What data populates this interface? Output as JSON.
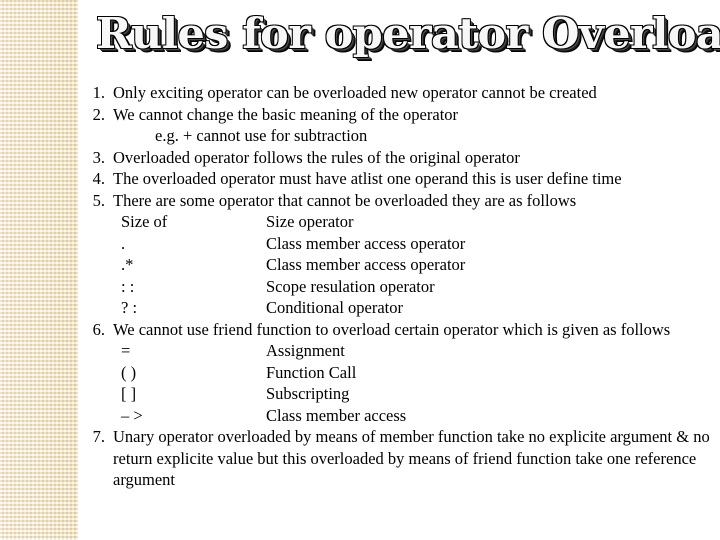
{
  "slide": {
    "title": "Rules for operator Overloading",
    "background_color": "#ffffff",
    "text_color": "#000000",
    "sidebar_color": "#f0e3c2"
  },
  "rules": [
    {
      "number": "1.",
      "text": "Only exciting operator can be overloaded new operator cannot be created"
    },
    {
      "number": "2.",
      "text": "We cannot change the basic meaning of the operator",
      "subnote": "e.g. + cannot use for subtraction"
    },
    {
      "number": "3.",
      "text": "Overloaded operator follows the rules of the original operator"
    },
    {
      "number": "4.",
      "text": "The overloaded operator must have atlist one operand this is user define time"
    },
    {
      "number": "5.",
      "text": "There are some operator that cannot be overloaded they are as follows"
    },
    {
      "number": "6.",
      "text": "We cannot use friend function to overload certain operator which is given as follows"
    },
    {
      "number": "7.",
      "text": "Unary operator overloaded by means of member function take no explicite argument &  no return explicite value but this overloaded by means of friend function take one reference argument"
    }
  ],
  "non_overloadable_table": {
    "rows": [
      {
        "symbol": "Size of",
        "description": "Size operator"
      },
      {
        "symbol": ".",
        "description": "Class member access operator"
      },
      {
        "symbol": ".*",
        "description": "Class member access operator"
      },
      {
        "symbol": ": :",
        "description": "Scope resulation operator"
      },
      {
        "symbol": "? :",
        "description": "Conditional operator"
      }
    ]
  },
  "friend_restricted_table": {
    "rows": [
      {
        "symbol": "=",
        "description": "Assignment"
      },
      {
        "symbol": "( )",
        "description": "Function Call"
      },
      {
        "symbol": "[ ]",
        "description": "Subscripting"
      },
      {
        "symbol": "– >",
        "description": "Class member access"
      }
    ]
  }
}
